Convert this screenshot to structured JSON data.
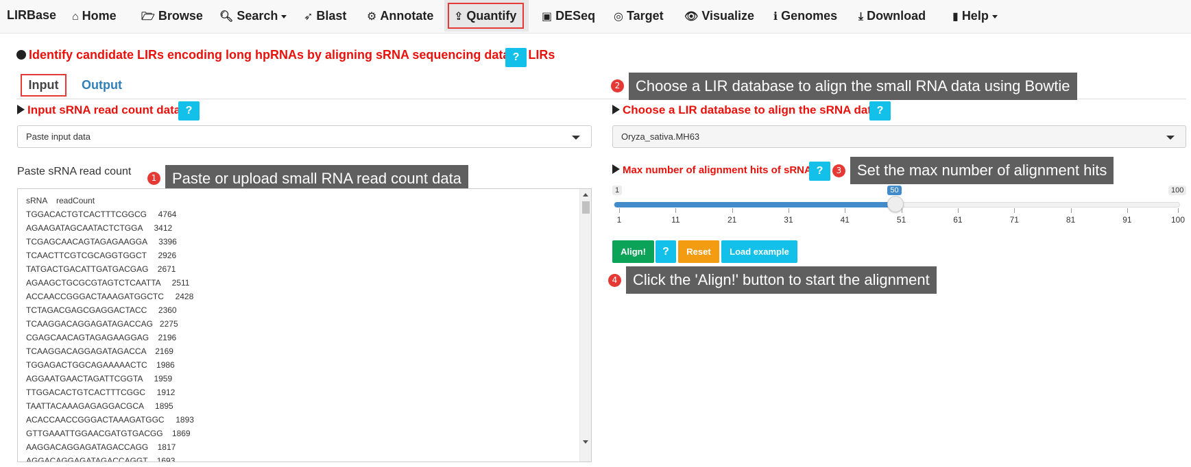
{
  "navbar": {
    "brand": "LIRBase",
    "items": [
      {
        "label": "Home",
        "icon": "home-icon"
      },
      {
        "label": "Browse",
        "icon": "folder-open-icon"
      },
      {
        "label": "Search",
        "icon": "search-icon"
      },
      {
        "label": "Blast",
        "icon": "rocket-icon"
      },
      {
        "label": "Annotate",
        "icon": "cogs-icon"
      },
      {
        "label": "Quantify",
        "icon": "upload-icon"
      },
      {
        "label": "DESeq",
        "icon": "s-box-icon"
      },
      {
        "label": "Target",
        "icon": "target-icon"
      },
      {
        "label": "Visualize",
        "icon": "eye-icon"
      },
      {
        "label": "Genomes",
        "icon": "info-icon"
      },
      {
        "label": "Download",
        "icon": "download-icon"
      },
      {
        "label": "Help",
        "icon": "book-icon"
      }
    ]
  },
  "headline": "Identify candidate LIRs encoding long hpRNAs by aligning sRNA sequencing data to LIRs",
  "help_label": "?",
  "tabs": {
    "input": "Input",
    "output": "Output"
  },
  "left": {
    "section_title": "Input sRNA read count data",
    "select_value": "Paste input data",
    "paste_label": "Paste sRNA read count",
    "textarea_lines": [
      "sRNA    readCount",
      "TGGACACTGTCACTTTCGGCG     4764",
      "AGAAGATAGCAATACTCTGGA     3412",
      "TCGAGCAACAGTAGAGAAGGA     3396",
      "TCAACTTCGTCGCAGGTGGCT     2926",
      "TATGACTGACATTGATGACGAG    2671",
      "AGAAGCTGCGCGTAGTCTCAATTA     2511",
      "ACCAACCGGGACTAAAGATGGCTC     2428",
      "TCTAGACGAGCGAGGACTACC     2360",
      "TCAAGGACAGGAGATAGACCAG   2275",
      "CGAGCAACAGTAGAGAAGGAG    2196",
      "TCAAGGACAGGAGATAGACCA    2169",
      "TGGAGACTGGCAGAAAAACTC    1986",
      "AGGAATGAACTAGATTCGGTA     1959",
      "TTGGACACTGTCACTTTCGGC     1912",
      "TAATTACAAAGAGAGGACGCA     1895",
      "ACACCAACCGGGACTAAAGATGGC     1893",
      "GTTGAAATTGGAACGATGTGACGG    1869",
      "AAGGACAGGAGATAGACCAGG    1817",
      "AGGACAGGAGATAGACCAGGT    1693"
    ]
  },
  "right": {
    "section_title": "Choose a LIR database to align the sRNA data",
    "select_value": "Oryza_sativa.MH63",
    "hits_title": "Max number of alignment hits of sRNA",
    "slider": {
      "min": 1,
      "max": 100,
      "value": 50,
      "min_label": "1",
      "max_label": "100",
      "value_label": "50",
      "ticks": [
        "1",
        "11",
        "21",
        "31",
        "41",
        "51",
        "61",
        "71",
        "81",
        "91",
        "100"
      ]
    },
    "buttons": {
      "align": "Align!",
      "help": "?",
      "reset": "Reset",
      "example": "Load example"
    }
  },
  "tips": [
    {
      "num": "1",
      "text": "Paste or upload small RNA read count data"
    },
    {
      "num": "2",
      "text": "Choose a LIR database to align the small RNA data using Bowtie"
    },
    {
      "num": "3",
      "text": "Set the max number of alignment hits"
    },
    {
      "num": "4",
      "text": "Click the 'Align!' button to start the alignment"
    }
  ]
}
